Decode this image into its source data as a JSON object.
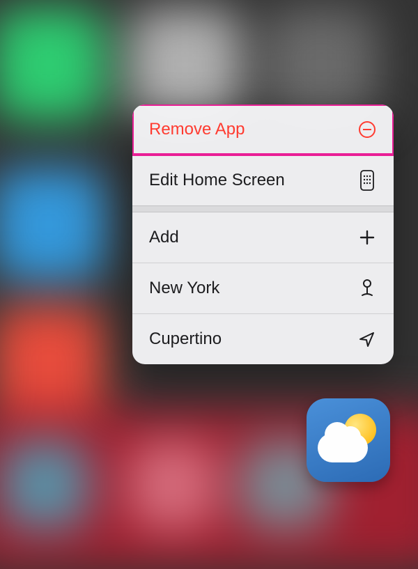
{
  "menu": {
    "items": [
      {
        "label": "Remove App",
        "icon": "remove-circle-icon",
        "destructive": true,
        "highlighted": true
      },
      {
        "label": "Edit Home Screen",
        "icon": "phone-grid-icon",
        "destructive": false
      },
      {
        "label": "Add",
        "icon": "plus-icon",
        "destructive": false
      },
      {
        "label": "New York",
        "icon": "pin-icon",
        "destructive": false
      },
      {
        "label": "Cupertino",
        "icon": "location-arrow-icon",
        "destructive": false
      }
    ]
  },
  "app": {
    "name": "Weather"
  },
  "colors": {
    "destructive": "#ff3b30",
    "highlight": "#e91e95"
  }
}
